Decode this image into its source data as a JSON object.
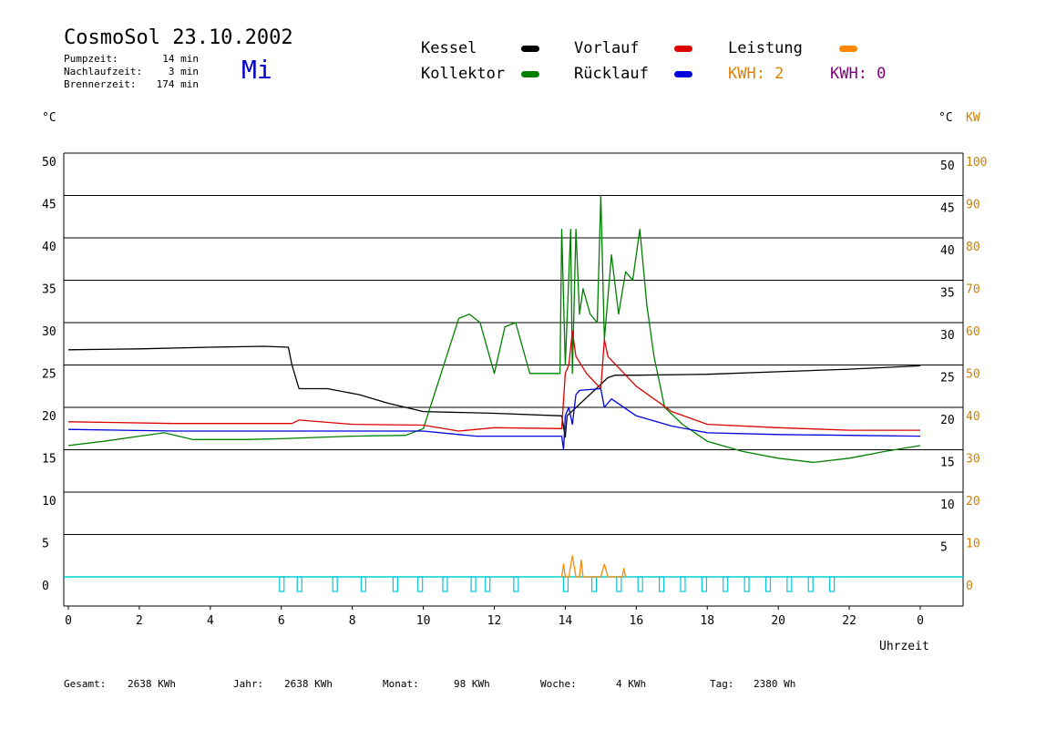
{
  "header": {
    "title": "CosmoSol 23.10.2002",
    "day": "Mi",
    "stats": [
      {
        "label": "Pumpzeit:",
        "value": "14 min"
      },
      {
        "label": "Nachlaufzeit:",
        "value": "3 min"
      },
      {
        "label": "Brennerzeit:",
        "value": "174 min"
      }
    ]
  },
  "legend": {
    "kessel": {
      "label": "Kessel",
      "color": "#000000"
    },
    "kollektor": {
      "label": "Kollektor",
      "color": "#008000"
    },
    "vorlauf": {
      "label": "Vorlauf",
      "color": "#dd0000"
    },
    "ruecklauf": {
      "label": "Rücklauf",
      "color": "#0000dd"
    },
    "leistung": {
      "label": "Leistung",
      "color": "#ff8800"
    },
    "kwh1": {
      "text": "KWH: 2",
      "color": "#e08000"
    },
    "kwh2": {
      "text": "KWH: 0",
      "color": "#800080"
    }
  },
  "axis_units": {
    "left": "°C",
    "right_c": "°C",
    "right_kw": "KW",
    "x": "Uhrzeit"
  },
  "footer": [
    {
      "label": "Gesamt:",
      "value": "2638 KWh"
    },
    {
      "label": "Jahr:",
      "value": "2638 KWh"
    },
    {
      "label": "Monat:",
      "value": "98 KWh"
    },
    {
      "label": "Woche:",
      "value": "4 KWh"
    },
    {
      "label": "Tag:",
      "value": "2380 Wh"
    }
  ],
  "chart_data": {
    "type": "line",
    "title": "CosmoSol 23.10.2002",
    "xlabel": "Uhrzeit",
    "ylabel": "°C",
    "xlim": [
      0,
      24
    ],
    "ylim": [
      -3.5,
      50
    ],
    "y2lim": [
      -7,
      100
    ],
    "x_tick_labels": [
      "0",
      "2",
      "4",
      "6",
      "8",
      "10",
      "12",
      "14",
      "16",
      "18",
      "20",
      "22",
      "0"
    ],
    "y_tick_labels": [
      "0",
      "5",
      "10",
      "15",
      "20",
      "25",
      "30",
      "35",
      "40",
      "45",
      "50"
    ],
    "y2_tick_labels_c": [
      "5",
      "10",
      "15",
      "20",
      "25",
      "30",
      "35",
      "40",
      "45",
      "50"
    ],
    "y2_tick_labels_kw": [
      "0",
      "10",
      "20",
      "30",
      "40",
      "50",
      "60",
      "70",
      "80",
      "90",
      "100"
    ],
    "grid": true,
    "series": [
      {
        "name": "Kessel",
        "color": "#000000",
        "x": [
          0,
          2,
          4,
          5.5,
          6.2,
          6.3,
          6.5,
          7.3,
          8.2,
          9,
          10,
          12,
          13.9,
          14.0,
          14.05,
          15.2,
          15.4,
          16,
          18,
          20,
          22,
          24
        ],
        "y": [
          26.8,
          26.9,
          27.1,
          27.2,
          27.1,
          25,
          22.2,
          22.2,
          21.5,
          20.5,
          19.5,
          19.3,
          19.0,
          16.5,
          19.0,
          23.5,
          23.8,
          23.8,
          23.9,
          24.2,
          24.5,
          24.9
        ]
      },
      {
        "name": "Kollektor",
        "color": "#008000",
        "x": [
          0,
          1,
          2,
          2.7,
          3.5,
          5,
          6,
          8,
          9.5,
          10,
          10.5,
          11,
          11.3,
          11.6,
          12,
          12.3,
          12.6,
          13,
          13.5,
          13.85,
          13.9,
          14.0,
          14.15,
          14.2,
          14.3,
          14.4,
          14.5,
          14.7,
          14.9,
          15.0,
          15.1,
          15.3,
          15.5,
          15.7,
          15.9,
          16.1,
          16.3,
          16.5,
          16.8,
          17.3,
          18,
          19,
          20,
          21,
          22,
          23,
          24
        ],
        "y": [
          15.5,
          16,
          16.6,
          17.0,
          16.2,
          16.2,
          16.3,
          16.6,
          16.7,
          17.5,
          24,
          30.5,
          31,
          30,
          24,
          29.5,
          30,
          24,
          24,
          24,
          41,
          25,
          41,
          24,
          41,
          31,
          34,
          31,
          30,
          45,
          28,
          38,
          31,
          36,
          35,
          41,
          32,
          26,
          20,
          18,
          16,
          14.8,
          14,
          13.5,
          14,
          14.8,
          15.5
        ]
      },
      {
        "name": "Vorlauf",
        "color": "#dd0000",
        "x": [
          0,
          3,
          6.3,
          6.5,
          8,
          10,
          11,
          12,
          13.9,
          14.0,
          14.1,
          14.2,
          14.3,
          14.6,
          15.0,
          15.1,
          15.2,
          16,
          17,
          18,
          20,
          22,
          24
        ],
        "y": [
          18.3,
          18.1,
          18.1,
          18.5,
          18.0,
          17.9,
          17.2,
          17.6,
          17.5,
          24,
          25,
          29,
          26,
          24,
          22.2,
          28,
          26,
          22.5,
          19.5,
          18,
          17.6,
          17.3,
          17.3
        ]
      },
      {
        "name": "Rücklauf",
        "color": "#0000dd",
        "x": [
          0,
          3,
          6,
          8,
          10,
          11,
          11.5,
          12,
          13.9,
          13.95,
          14.0,
          14.1,
          14.2,
          14.3,
          14.4,
          15.0,
          15.1,
          15.3,
          16,
          17,
          18,
          20,
          22,
          24
        ],
        "y": [
          17.4,
          17.2,
          17.2,
          17.2,
          17.2,
          16.8,
          16.6,
          16.6,
          16.6,
          15.0,
          19.0,
          20.0,
          18.0,
          21.5,
          22.0,
          22.2,
          20.0,
          21.0,
          19.0,
          17.8,
          17.0,
          16.8,
          16.7,
          16.6
        ]
      },
      {
        "name": "Leistung",
        "axis": "kw",
        "color": "#ff8800",
        "x": [
          13.9,
          13.95,
          14.0,
          14.1,
          14.2,
          14.3,
          14.4,
          14.45,
          14.5,
          14.6,
          15.0,
          15.1,
          15.2,
          15.3,
          15.6,
          15.65,
          15.7
        ],
        "y": [
          0,
          3,
          0,
          0,
          5,
          0,
          0,
          4,
          0,
          0,
          0,
          3,
          0,
          0,
          0,
          2,
          0
        ]
      }
    ],
    "pump_markers_hours": [
      6.0,
      6.5,
      7.5,
      8.3,
      9.2,
      9.9,
      10.6,
      11.4,
      11.8,
      12.6,
      14.0,
      14.8,
      15.5,
      16.1,
      16.7,
      17.3,
      17.9,
      18.5,
      19.1,
      19.7,
      20.3,
      20.9,
      21.5
    ]
  }
}
